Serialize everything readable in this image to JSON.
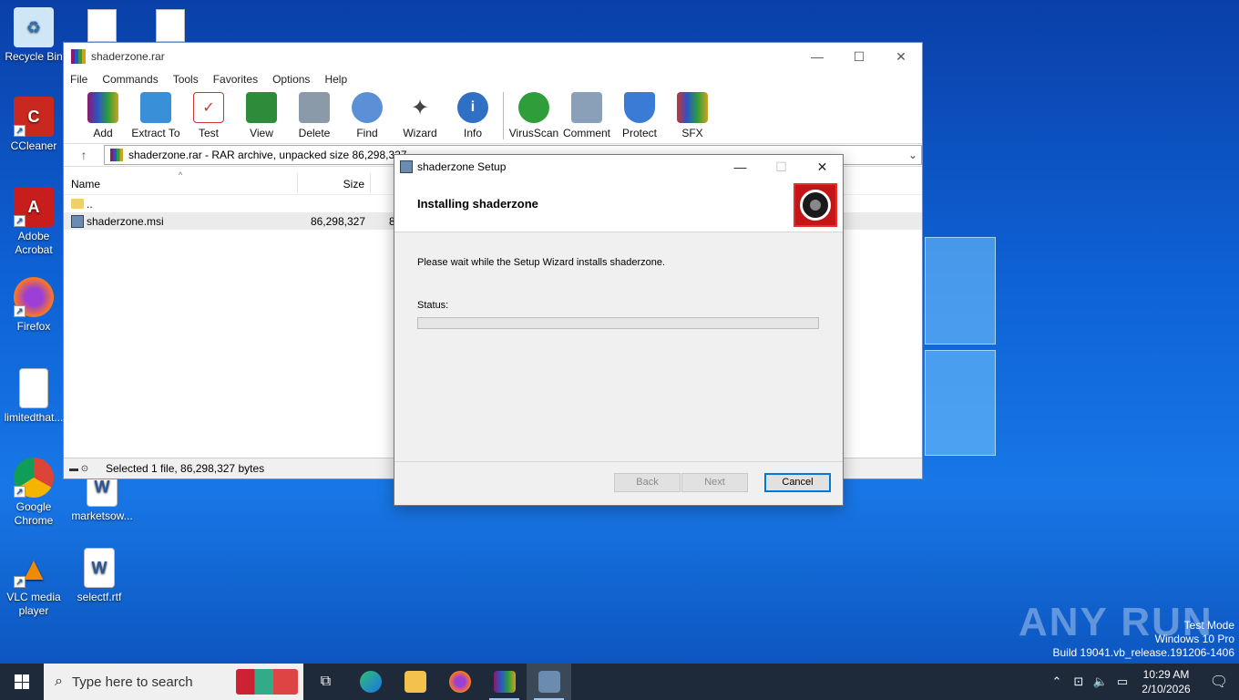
{
  "desktop": {
    "icons": [
      {
        "label": "Recycle Bin"
      },
      {
        "label": "CCleaner"
      },
      {
        "label": "Adobe Acrobat"
      },
      {
        "label": "Firefox"
      },
      {
        "label": "limitedthat..."
      },
      {
        "label": "Google Chrome"
      },
      {
        "label": "marketsow..."
      },
      {
        "label": "VLC media player"
      },
      {
        "label": "selectf.rtf"
      }
    ],
    "watermark": {
      "brand": "ANY RUN",
      "line1": "Test Mode",
      "line2": "Windows 10 Pro",
      "line3": "Build 19041.vb_release.191206-1406"
    }
  },
  "winrar": {
    "title": "shaderzone.rar",
    "menu": [
      "File",
      "Commands",
      "Tools",
      "Favorites",
      "Options",
      "Help"
    ],
    "toolbar": [
      "Add",
      "Extract To",
      "Test",
      "View",
      "Delete",
      "Find",
      "Wizard",
      "Info",
      "VirusScan",
      "Comment",
      "Protect",
      "SFX"
    ],
    "path": "shaderzone.rar - RAR archive, unpacked size 86,298,327",
    "columns": {
      "name": "Name",
      "size": "Size"
    },
    "rows": [
      {
        "name": "..",
        "size": ""
      },
      {
        "name": "shaderzone.msi",
        "size": "86,298,327",
        "extra": "8"
      }
    ],
    "status": "Selected 1 file, 86,298,327 bytes"
  },
  "setup": {
    "title": "shaderzone Setup",
    "heading": "Installing shaderzone",
    "message": "Please wait while the Setup Wizard installs shaderzone.",
    "status_label": "Status:",
    "progress": 0,
    "buttons": {
      "back": "Back",
      "next": "Next",
      "cancel": "Cancel"
    }
  },
  "taskbar": {
    "search_placeholder": "Type here to search",
    "time": "10:29 AM",
    "date": "2/10/2026"
  },
  "colors": {
    "accent": "#0078d7",
    "taskbar": "#1e2a3a"
  }
}
